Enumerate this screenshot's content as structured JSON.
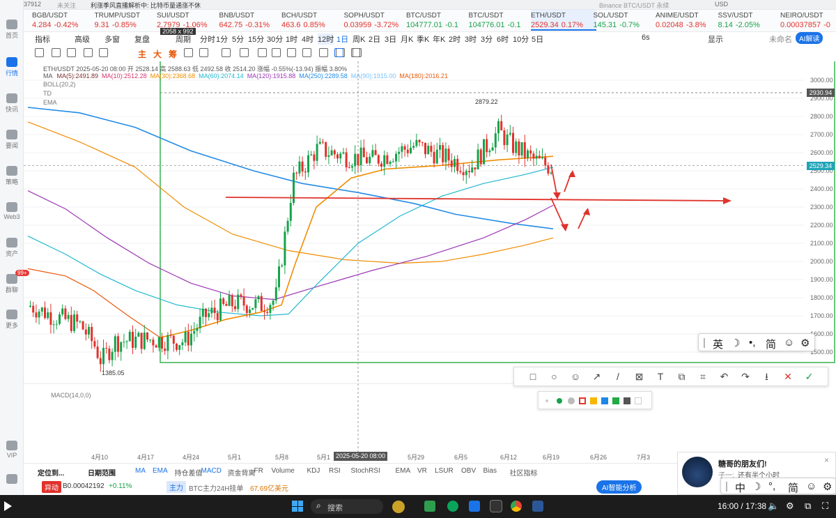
{
  "top_strip": {
    "left_text": "37912",
    "unfollow": "未关注",
    "notice": "利涨季风直播解析中: 比特币量通涨不休",
    "search": "Binance BTC/USDT 永续",
    "currency": "USD"
  },
  "sidebar": {
    "items": [
      {
        "label": "首页",
        "icon": "home-icon"
      },
      {
        "label": "行情",
        "icon": "chart-bars-icon",
        "active": true
      },
      {
        "label": "快讯",
        "icon": "news-icon"
      },
      {
        "label": "要闻",
        "icon": "document-icon"
      },
      {
        "label": "策略",
        "icon": "strategy-icon"
      },
      {
        "label": "Web3",
        "icon": "globe-icon"
      },
      {
        "label": "资产",
        "icon": "wallet-icon"
      },
      {
        "label": "群聊",
        "icon": "chat-icon"
      },
      {
        "label": "更多",
        "icon": "grid-icon"
      },
      {
        "label": "VIP",
        "icon": "vip-icon"
      },
      {
        "label": "",
        "icon": "settings-icon"
      }
    ],
    "badge": "99+"
  },
  "tickers": [
    {
      "sym": "BGB/USDT",
      "price": "4.284",
      "chg": "-0.42%",
      "dir": "down"
    },
    {
      "sym": "TRUMP/USDT",
      "price": "9.31",
      "chg": "-0.85%",
      "dir": "down"
    },
    {
      "sym": "SUI/USDT",
      "price": "2.7979",
      "chg": "-1.06%",
      "dir": "down"
    },
    {
      "sym": "BNB/USDT",
      "price": "642.75",
      "chg": "-0.31%",
      "dir": "down"
    },
    {
      "sym": "BCH/USDT",
      "price": "463.6",
      "chg": "0.85%",
      "dir": "down"
    },
    {
      "sym": "SOPH/USDT",
      "price": "0.03959",
      "chg": "-3.72%",
      "dir": "down"
    },
    {
      "sym": "BTC/USDT",
      "price": "104777.01",
      "chg": "-0.1",
      "dir": "up"
    },
    {
      "sym": "BTC/USDT",
      "price": "104776.01",
      "chg": "-0.1",
      "dir": "up"
    },
    {
      "sym": "ETH/USDT",
      "price": "2529.34",
      "chg": "0.17%",
      "dir": "down",
      "active": true
    },
    {
      "sym": "SOL/USDT",
      "price": "145.31",
      "chg": "-0.7%",
      "dir": "up"
    },
    {
      "sym": "ANIME/USDT",
      "price": "0.02048",
      "chg": "-3.8%",
      "dir": "down"
    },
    {
      "sym": "SSV/USDT",
      "price": "8.14",
      "chg": "-2.05%",
      "dir": "up"
    },
    {
      "sym": "NEIRO/USDT",
      "price": "0.00037857",
      "chg": "-0",
      "dir": "down"
    }
  ],
  "toolbar": {
    "indicator": "指标",
    "advanced": "高级",
    "multi": "多窗",
    "replay": "复盘",
    "period": "周期",
    "timeframes": [
      "分时",
      "1分",
      "5分",
      "15分",
      "30分",
      "1时",
      "4时",
      "12时",
      "1日",
      "周K",
      "2日",
      "3日",
      "月K",
      "季K",
      "年K",
      "2时",
      "3时",
      "3分",
      "6时",
      "10分",
      "5日"
    ],
    "size_label": "2058 x 992",
    "right_items": [
      "6s",
      "显示",
      "未命名",
      "AI解读"
    ]
  },
  "legend": {
    "line1": "ETH/USDT  2025-05-20 08:00  开 2528.14  高 2588.63  低 2492.58  收 2514.20  涨幅 -0.55%(-13.94)  振幅 3.80%",
    "ma_label": "MA",
    "mas": [
      {
        "t": "MA(5):2491.89",
        "color": "#7b2f2f"
      },
      {
        "t": "MA(10):2512.28",
        "color": "#d6336c"
      },
      {
        "t": "MA(30):2368.68",
        "color": "#f08c00"
      },
      {
        "t": "MA(60):2074.14",
        "color": "#22b8cf"
      },
      {
        "t": "MA(120):1915.88",
        "color": "#9c36b5"
      },
      {
        "t": "MA(250):2289.58",
        "color": "#228be6"
      },
      {
        "t": "MA(90):1915.00",
        "color": "#74c0fc"
      },
      {
        "t": "MA(180):2016.21",
        "color": "#e8590c"
      }
    ],
    "boll": "BOLL(20,2)",
    "td": "TD",
    "ema": "EMA",
    "macd": "MACD(14,0,0)"
  },
  "price_axis": [
    "3000.00",
    "2900.00",
    "2800.00",
    "2700.00",
    "2600.00",
    "2500.00",
    "2400.00",
    "2300.00",
    "2200.00",
    "2100.00",
    "2000.00",
    "1900.00",
    "1800.00",
    "1700.00",
    "1600.00",
    "1500.00"
  ],
  "price_tags": {
    "high_line": "2930.94",
    "current": "2529.34"
  },
  "annotations": {
    "high": "2879.22",
    "low": "1385.05"
  },
  "x_axis": [
    "4月10",
    "4月17",
    "4月24",
    "5月1",
    "5月8",
    "5月1",
    "5月29",
    "6月5",
    "6月12",
    "6月19",
    "6月26",
    "7月3"
  ],
  "crosshair_date": "2025-05-20 08:00",
  "bottom_bar": {
    "locate": "定位到...",
    "range": "日期范围",
    "tabs": [
      "MA",
      "EMA",
      "持仓差值",
      "MACD",
      "资金背离",
      "FR",
      "Volume",
      "KDJ",
      "RSI",
      "StochRSI",
      "EMA",
      "VR",
      "LSUR",
      "OBV",
      "Bias",
      "社区指标"
    ]
  },
  "status": {
    "tag": "异动",
    "ticker": "B0.00042192",
    "chg": "+0.11%",
    "main": "主力",
    "flow": "BTC主力24H挂单",
    "amount": "67.69亿美元",
    "ai": "AI智能分析"
  },
  "ime": {
    "items": [
      "英",
      "简"
    ]
  },
  "chat": {
    "title": "糖哥的朋友们!",
    "msg_user": "子一:",
    "msg": "还有半个小时"
  },
  "taskbar": {
    "search": "搜索",
    "time": "16:00 / 17:38"
  }
}
